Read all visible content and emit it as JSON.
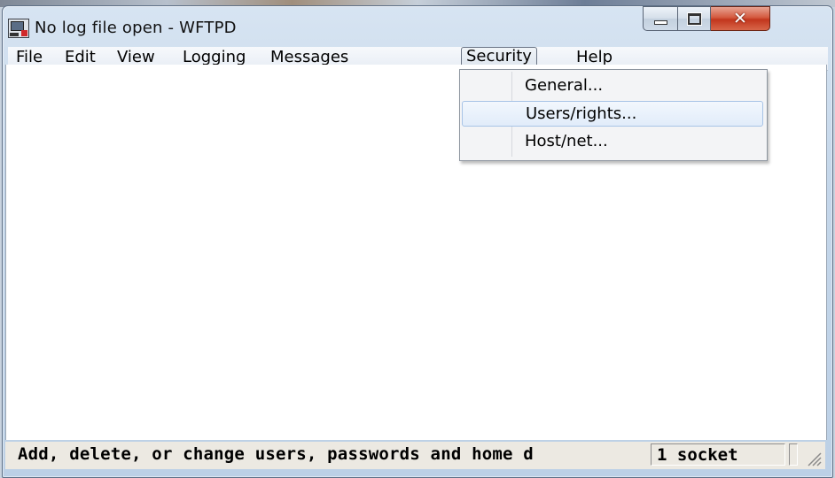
{
  "window": {
    "title": "No log file open - WFTPD",
    "icon": "wftpd-app-icon",
    "controls": {
      "minimize": "minimize-icon",
      "maximize": "maximize-icon",
      "close": "✕"
    }
  },
  "menubar": {
    "items": [
      {
        "label": "File"
      },
      {
        "label": "Edit"
      },
      {
        "label": "View"
      },
      {
        "label": "Logging"
      },
      {
        "label": "Messages"
      },
      {
        "label": "Security",
        "state": "open"
      },
      {
        "label": "Help"
      }
    ]
  },
  "security_menu": {
    "items": [
      {
        "label": "General..."
      },
      {
        "label": "Users/rights...",
        "state": "highlighted"
      },
      {
        "label": "Host/net..."
      }
    ]
  },
  "statusbar": {
    "message": "Add, delete, or change users, passwords and home d",
    "sockets": "1 socket"
  },
  "colors": {
    "close_button": "#c2361d",
    "menu_highlight": "#e1ecfa",
    "client_background": "#ffffff"
  }
}
